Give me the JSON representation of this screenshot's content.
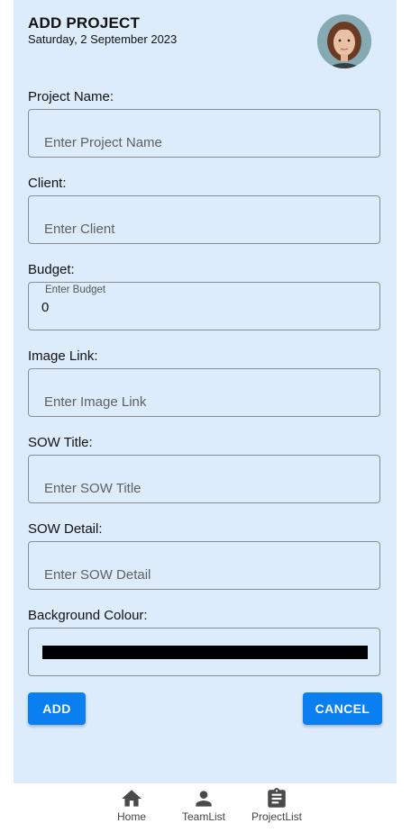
{
  "header": {
    "title": "ADD PROJECT",
    "date": "Saturday, 2 September 2023"
  },
  "form": {
    "project_name": {
      "label": "Project Name:",
      "placeholder": "Enter Project Name"
    },
    "client": {
      "label": "Client:",
      "placeholder": "Enter Client"
    },
    "budget": {
      "label": "Budget:",
      "floating_label": "Enter Budget",
      "value": "0"
    },
    "image_link": {
      "label": "Image Link:",
      "placeholder": "Enter Image Link"
    },
    "sow_title": {
      "label": "SOW Title:",
      "placeholder": "Enter SOW Title"
    },
    "sow_detail": {
      "label": "SOW Detail:",
      "placeholder": "Enter SOW Detail"
    },
    "background_colour": {
      "label": "Background Colour:",
      "value_color": "#000000"
    }
  },
  "actions": {
    "add_label": "ADD",
    "cancel_label": "CANCEL"
  },
  "bottom_nav": {
    "items": [
      {
        "label": "Home",
        "icon": "home-icon"
      },
      {
        "label": "TeamList",
        "icon": "person-icon"
      },
      {
        "label": "ProjectList",
        "icon": "clipboard-icon"
      }
    ]
  },
  "colors": {
    "background": "#dcecfb",
    "accent": "#0a7ff0"
  }
}
